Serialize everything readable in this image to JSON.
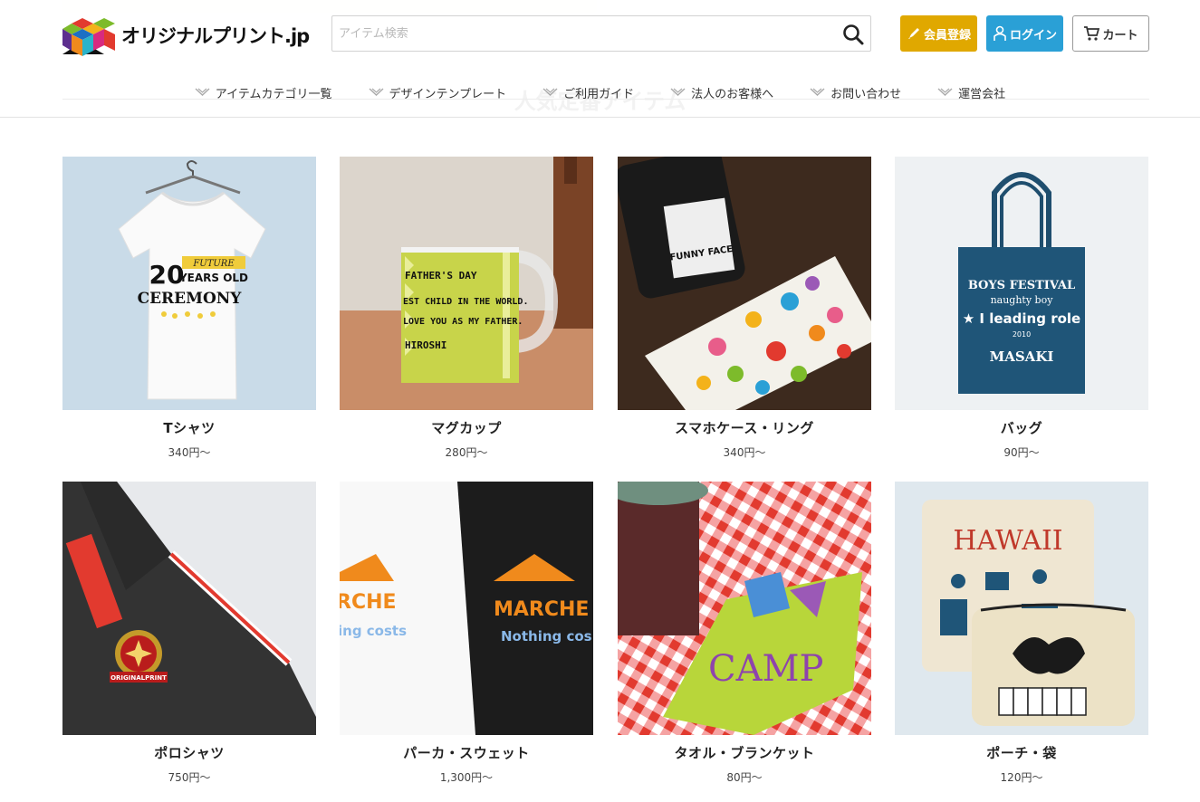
{
  "header": {
    "logo_text": "オリジナルプリント.jp",
    "search_placeholder": "アイテム検索",
    "register_label": "会員登録",
    "login_label": "ログイン",
    "cart_label": "カート",
    "section_title": "人気定番アイテム"
  },
  "nav": [
    {
      "label": "アイテムカテゴリ一覧"
    },
    {
      "label": "デザインテンプレート"
    },
    {
      "label": "ご利用ガイド"
    },
    {
      "label": "法人のお客様へ"
    },
    {
      "label": "お問い合わせ"
    },
    {
      "label": "運営会社"
    }
  ],
  "products": [
    {
      "name": "Tシャツ",
      "price": "340円～",
      "art": {
        "l1": "20",
        "l2": "YEARS OLD",
        "l3": "CEREMONY",
        "small": "FUTURE"
      }
    },
    {
      "name": "マグカップ",
      "price": "280円～",
      "art": {
        "l1": "FATHER'S DAY",
        "l2": "EST CHILD IN THE WORLD.",
        "l3": "LOVE YOU AS MY FATHER.",
        "l4": "HIROSHI"
      }
    },
    {
      "name": "スマホケース・リング",
      "price": "340円～",
      "art": {
        "l1": "FUNNY FACE"
      }
    },
    {
      "name": "バッグ",
      "price": "90円～",
      "art": {
        "l1": "BOYS FESTIVAL",
        "l2": "naughty boy",
        "l3": "★ I leading role",
        "l4": "2010",
        "l5": "MASAKI"
      }
    },
    {
      "name": "ポロシャツ",
      "price": "750円～",
      "art": {
        "l1": "ORIGINALPRINT"
      }
    },
    {
      "name": "パーカ・スウェット",
      "price": "1,300円～",
      "art": {
        "l1": "RCHE",
        "l2": "ing costs",
        "l3": "MARCHE",
        "l4": "Nothing cos"
      }
    },
    {
      "name": "タオル・ブランケット",
      "price": "80円～",
      "art": {
        "l1": "CAMP"
      }
    },
    {
      "name": "ポーチ・袋",
      "price": "120円～",
      "art": {
        "l1": "HAWAII"
      }
    }
  ],
  "colors": {
    "register": "#e0a800",
    "login": "#2aa0d6",
    "border": "#d2d2d2"
  }
}
